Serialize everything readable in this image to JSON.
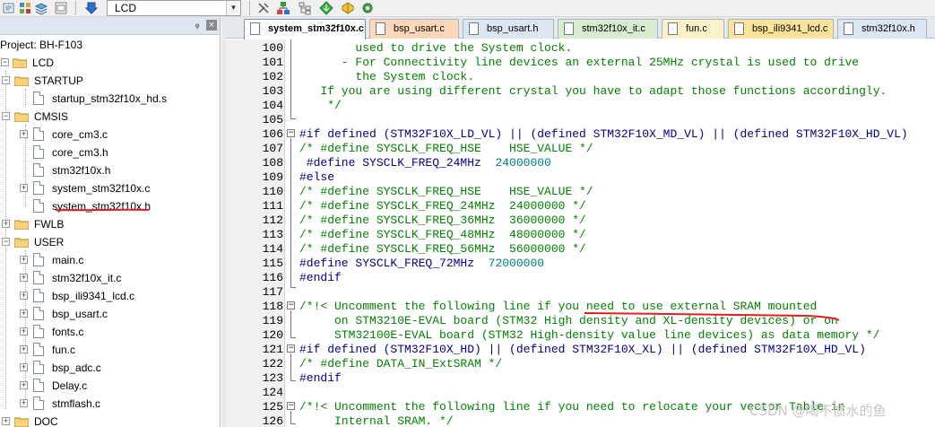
{
  "toolbar": {
    "target": "LCD",
    "target_arrow": "▼"
  },
  "project": {
    "pin": "ᵩ",
    "close": "×",
    "title": "Project: BH-F103",
    "target": "LCD",
    "groups": [
      {
        "name": "STARTUP",
        "files": [
          "startup_stm32f10x_hd.s"
        ]
      },
      {
        "name": "CMSIS",
        "files": [
          "core_cm3.c",
          "core_cm3.h",
          "stm32f10x.h",
          "system_stm32f10x.c",
          "system_stm32f10x.h"
        ]
      },
      {
        "name": "FWLB",
        "files": []
      },
      {
        "name": "USER",
        "files": [
          "main.c",
          "stm32f10x_it.c",
          "bsp_ili9341_lcd.c",
          "bsp_usart.c",
          "fonts.c",
          "fun.c",
          "bsp_adc.c",
          "Delay.c",
          "stmflash.c"
        ]
      },
      {
        "name": "DOC",
        "files": []
      }
    ]
  },
  "tabs": [
    {
      "label": "system_stm32f10x.c",
      "active": true,
      "color": "#ffffff"
    },
    {
      "label": "bsp_usart.c",
      "active": false,
      "color": "#fcd8b8"
    },
    {
      "label": "bsp_usart.h",
      "active": false,
      "color": "#dce6f2"
    },
    {
      "label": "stm32f10x_it.c",
      "active": false,
      "color": "#d8ecd0"
    },
    {
      "label": "fun.c",
      "active": false,
      "color": "#fbf2c8"
    },
    {
      "label": "bsp_ili9341_lcd.c",
      "active": false,
      "color": "#fde29a"
    },
    {
      "label": "stm32f10x.h",
      "active": false,
      "color": "#dce6f2"
    }
  ],
  "editor": {
    "lines": [
      {
        "n": "100",
        "text": "        used to drive the System clock.",
        "kind": "comment"
      },
      {
        "n": "101",
        "text": "      - For Connectivity line devices an external 25MHz crystal is used to drive",
        "kind": "comment"
      },
      {
        "n": "102",
        "text": "        the System clock.",
        "kind": "comment"
      },
      {
        "n": "103",
        "text": "   If you are using different crystal you have to adapt those functions accordingly.",
        "kind": "comment"
      },
      {
        "n": "104",
        "text": "    */",
        "kind": "comment"
      },
      {
        "n": "105",
        "text": "",
        "kind": "text"
      },
      {
        "n": "106",
        "text": "#if defined (STM32F10X_LD_VL) || (defined STM32F10X_MD_VL) || (defined STM32F10X_HD_VL)",
        "kind": "pre"
      },
      {
        "n": "107",
        "text": "/* #define SYSCLK_FREQ_HSE    HSE_VALUE */",
        "kind": "comment"
      },
      {
        "n": "108",
        "text": " #define SYSCLK_FREQ_24MHz  24000000",
        "kind": "define"
      },
      {
        "n": "109",
        "text": "#else",
        "kind": "pre"
      },
      {
        "n": "110",
        "text": "/* #define SYSCLK_FREQ_HSE    HSE_VALUE */",
        "kind": "comment"
      },
      {
        "n": "111",
        "text": "/* #define SYSCLK_FREQ_24MHz  24000000 */",
        "kind": "comment"
      },
      {
        "n": "112",
        "text": "/* #define SYSCLK_FREQ_36MHz  36000000 */",
        "kind": "comment"
      },
      {
        "n": "113",
        "text": "/* #define SYSCLK_FREQ_48MHz  48000000 */",
        "kind": "comment"
      },
      {
        "n": "114",
        "text": "/* #define SYSCLK_FREQ_56MHz  56000000 */",
        "kind": "comment"
      },
      {
        "n": "115",
        "text": "#define SYSCLK_FREQ_72MHz  72000000",
        "kind": "define"
      },
      {
        "n": "116",
        "text": "#endif",
        "kind": "pre"
      },
      {
        "n": "117",
        "text": "",
        "kind": "text"
      },
      {
        "n": "118",
        "text": "/*!< Uncomment the following line if you need to use external SRAM mounted",
        "kind": "comment"
      },
      {
        "n": "119",
        "text": "     on STM3210E-EVAL board (STM32 High density and XL-density devices) or on",
        "kind": "comment"
      },
      {
        "n": "120",
        "text": "     STM32100E-EVAL board (STM32 High-density value line devices) as data memory */",
        "kind": "comment"
      },
      {
        "n": "121",
        "text": "#if defined (STM32F10X_HD) || (defined STM32F10X_XL) || (defined STM32F10X_HD_VL)",
        "kind": "pre"
      },
      {
        "n": "122",
        "text": "/* #define DATA_IN_ExtSRAM */",
        "kind": "comment"
      },
      {
        "n": "123",
        "text": "#endif",
        "kind": "pre"
      },
      {
        "n": "124",
        "text": "",
        "kind": "text"
      },
      {
        "n": "125",
        "text": "/*!< Uncomment the following line if you need to relocate your vector Table in",
        "kind": "comment"
      },
      {
        "n": "126",
        "text": "     Internal SRAM. */",
        "kind": "comment"
      }
    ]
  },
  "watermark": "CSDN @喝不惯水的鱼",
  "colors": {
    "comment": "#008000",
    "preprocessor": "#000080",
    "number": "#008080",
    "annotation": "#e02020"
  }
}
